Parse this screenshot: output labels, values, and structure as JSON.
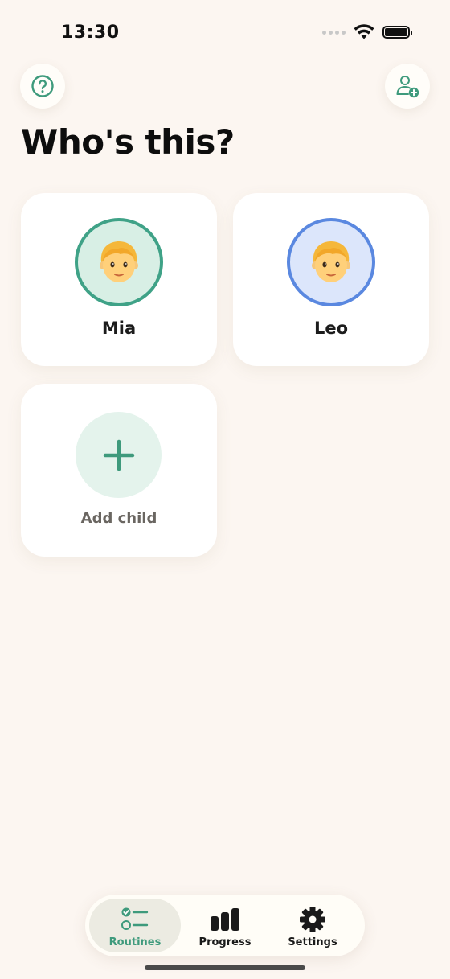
{
  "status_bar": {
    "time": "13:30"
  },
  "header": {
    "title": "Who's this?"
  },
  "children": [
    {
      "name": "Mia",
      "ring_color": "#3fa287",
      "bg_color": "#d8efe5"
    },
    {
      "name": "Leo",
      "ring_color": "#5a88e0",
      "bg_color": "#dce6fb"
    }
  ],
  "add_child": {
    "label": "Add child"
  },
  "tab_bar": {
    "tabs": [
      {
        "label": "Routines",
        "icon": "routines-icon",
        "selected": true
      },
      {
        "label": "Progress",
        "icon": "progress-icon",
        "selected": false
      },
      {
        "label": "Settings",
        "icon": "settings-icon",
        "selected": false
      }
    ]
  },
  "colors": {
    "accent": "#3e9a7c",
    "background": "#fcf6f1",
    "card": "#ffffff"
  }
}
